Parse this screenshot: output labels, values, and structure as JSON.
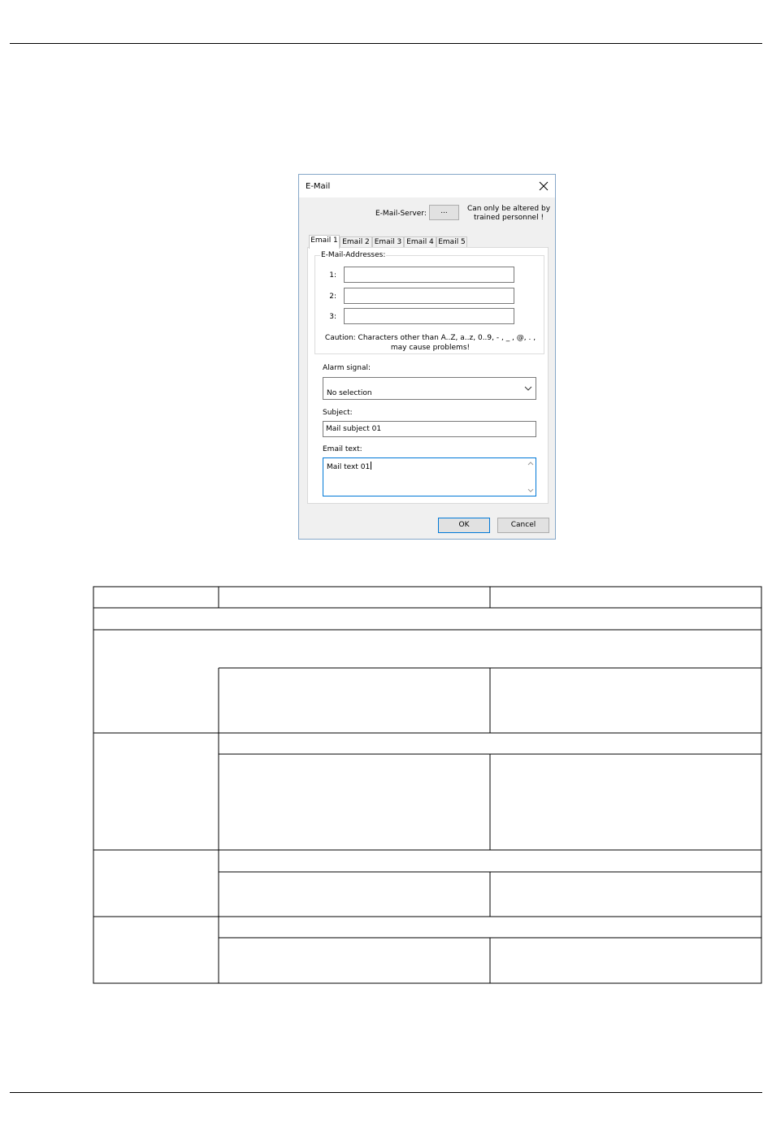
{
  "dialog": {
    "title": "E-Mail",
    "server_label": "E-Mail-Server:",
    "server_button": "...",
    "server_note": "Can only be altered by trained personnel !",
    "tabs": [
      "Email 1",
      "Email 2",
      "Email 3",
      "Email 4",
      "Email 5"
    ],
    "addresses_group": "E-Mail-Addresses:",
    "address_labels": [
      "1:",
      "2:",
      "3:"
    ],
    "address_values": [
      "",
      "",
      ""
    ],
    "caution_line1": "Caution: Characters other than A..Z, a..z, 0..9, - , _ , @, . ,",
    "caution_line2": "may cause problems!",
    "alarm_label": "Alarm signal:",
    "alarm_value": "No selection",
    "subject_label": "Subject:",
    "subject_value": "Mail subject 01",
    "email_text_label": "Email text:",
    "email_text_value": "Mail text 01",
    "ok_label": "OK",
    "cancel_label": "Cancel"
  }
}
